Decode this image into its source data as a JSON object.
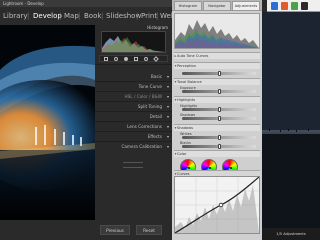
{
  "left_app": {
    "title": "Lightroom - Develop",
    "modules": [
      {
        "label": "Library"
      },
      {
        "label": "Develop"
      },
      {
        "label": "Map"
      },
      {
        "label": "Book"
      },
      {
        "label": "Slideshow"
      },
      {
        "label": "Print"
      },
      {
        "label": "Web"
      }
    ],
    "histogram_label": "Histogram",
    "panel_sections": [
      {
        "label": "Basic"
      },
      {
        "label": "Tone Curve"
      },
      {
        "label": "HSL / Color / B&W"
      },
      {
        "label": "Split Toning"
      },
      {
        "label": "Detail"
      },
      {
        "label": "Lens Corrections"
      },
      {
        "label": "Effects"
      },
      {
        "label": "Camera Calibration"
      }
    ],
    "buttons": {
      "previous": "Previous",
      "reset": "Reset"
    },
    "colors": {
      "accent": "#ffffff",
      "panel": "#2a2a2a"
    }
  },
  "right_app": {
    "tabs": [
      {
        "label": "Histogram"
      },
      {
        "label": "Navigator"
      },
      {
        "label": "Adjustments"
      }
    ],
    "sections": [
      {
        "label": "Auto Tone Curves"
      },
      {
        "label": "Perception"
      },
      {
        "label": "Tonal Balance"
      },
      {
        "label": "Highlights"
      },
      {
        "label": "Shadows"
      },
      {
        "label": "Color"
      },
      {
        "label": "Curves"
      }
    ],
    "labels": {
      "exposure": "Exposure",
      "contrast": "Contrast",
      "highlights": "Highlights",
      "shadows": "Shadows",
      "whites": "Whites",
      "blacks": "Blacks"
    },
    "status": "1/5 Adjustments"
  }
}
